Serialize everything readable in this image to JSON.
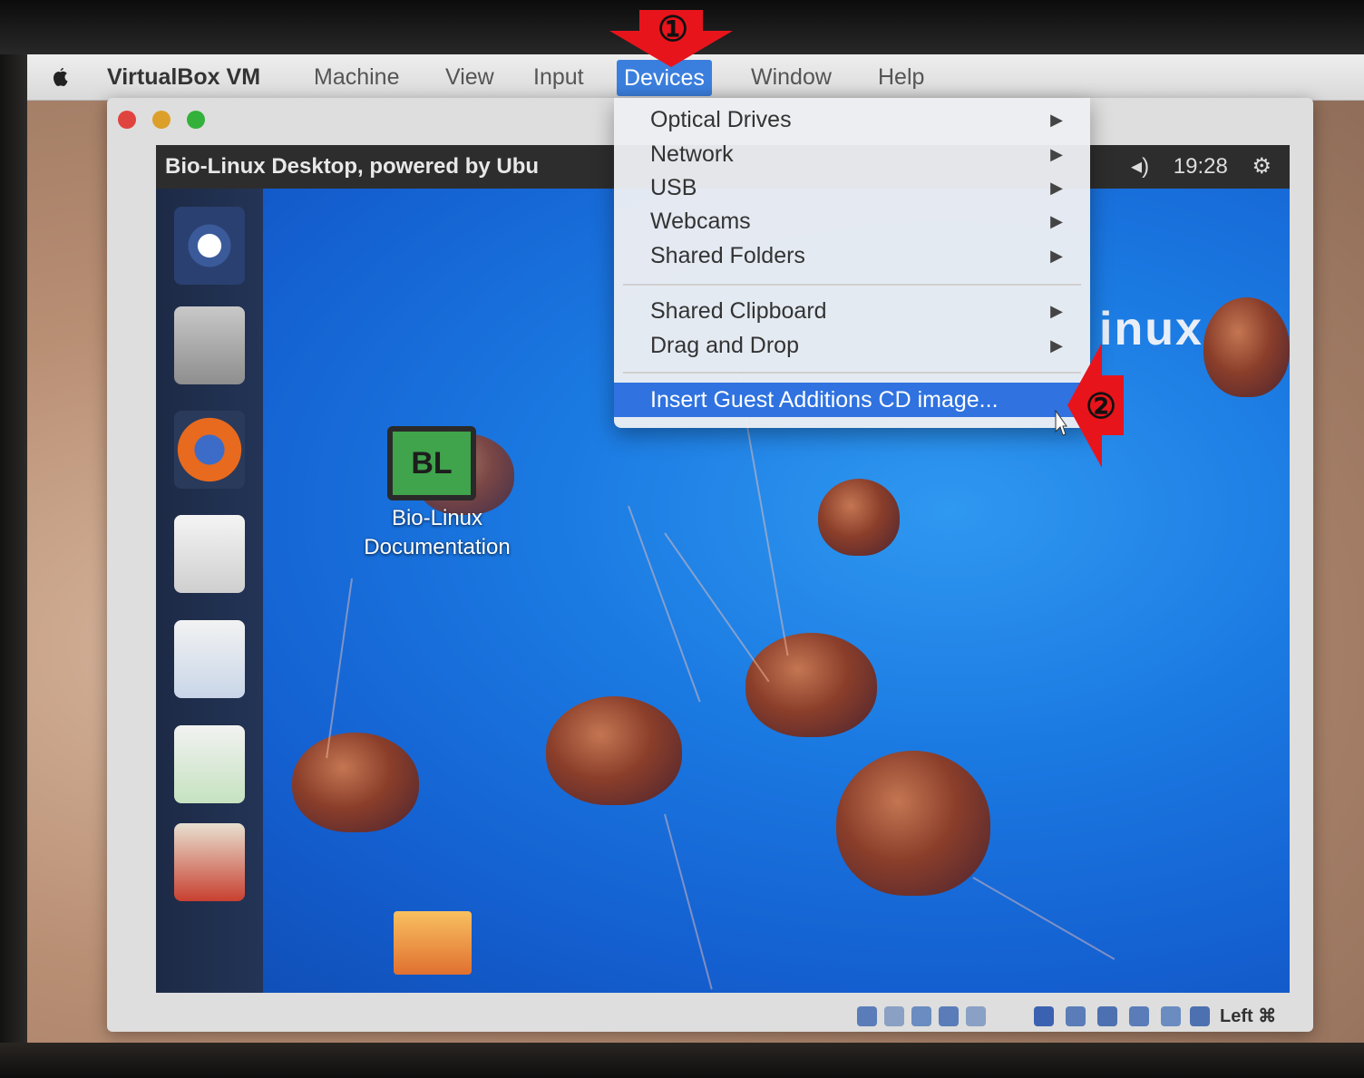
{
  "menubar": {
    "app_name": "VirtualBox VM",
    "items": [
      "Machine",
      "View",
      "Input",
      "Devices",
      "Window",
      "Help"
    ],
    "active": "Devices"
  },
  "guest": {
    "title": "Bio-Linux Desktop, powered by Ubu",
    "clock": "19:28",
    "wallpaper_word": "inux",
    "desktop_icon": {
      "badge": "BL",
      "label_line1": "Bio-Linux",
      "label_line2": "Documentation"
    }
  },
  "devices_menu": {
    "group1": [
      "Optical Drives",
      "Network",
      "USB",
      "Webcams",
      "Shared Folders"
    ],
    "group2": [
      "Shared Clipboard",
      "Drag and Drop"
    ],
    "action": "Insert Guest Additions CD image..."
  },
  "statusbar": {
    "host_key": "Left ⌘"
  },
  "annotations": {
    "step1": "①",
    "step2": "②"
  },
  "colors": {
    "menu_highlight": "#2f72e0",
    "annotation_arrow": "#e8141c",
    "wallpaper": "#1b7ae2"
  }
}
